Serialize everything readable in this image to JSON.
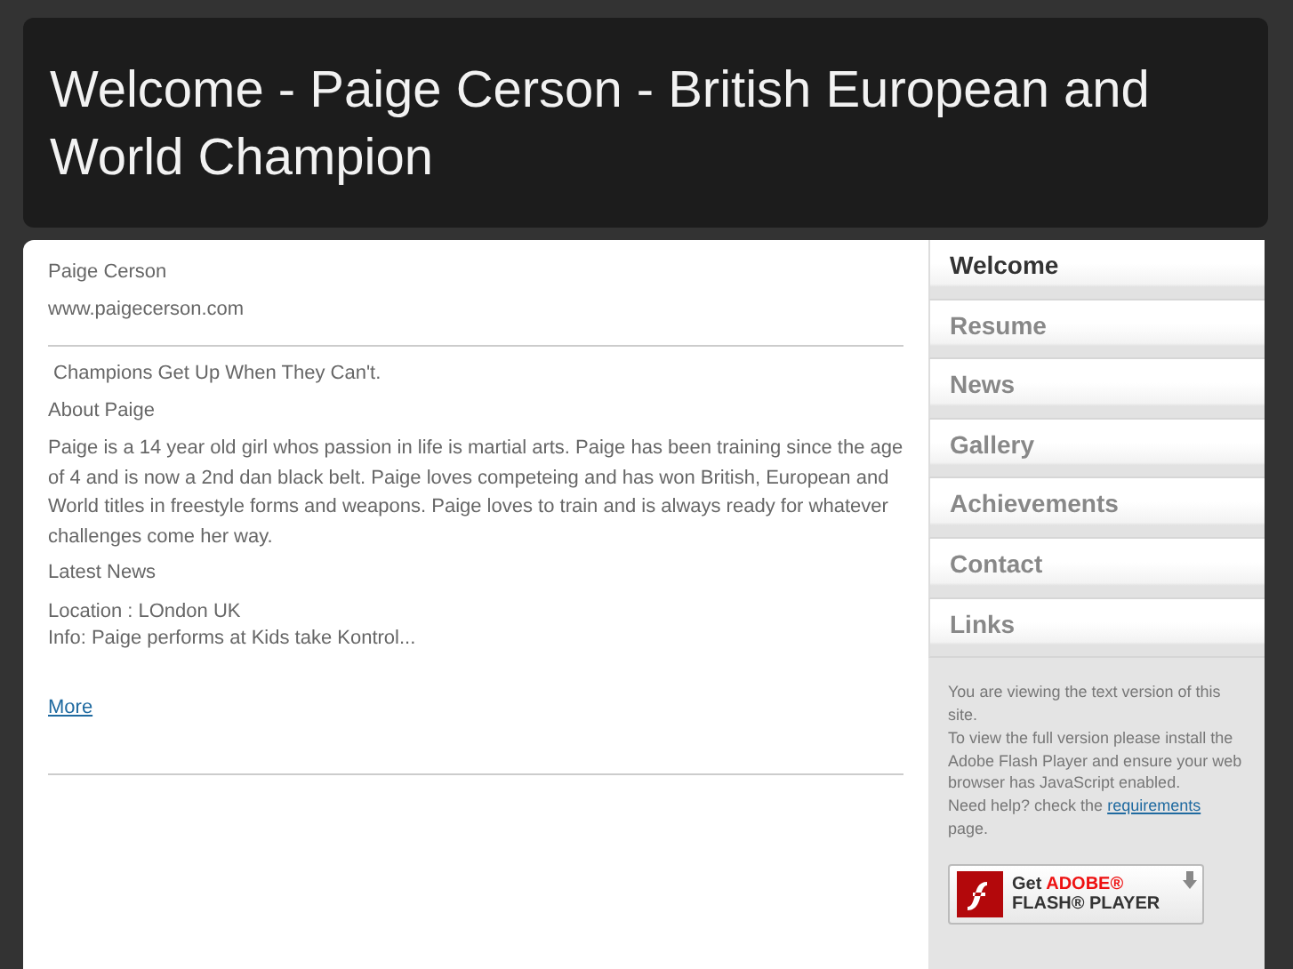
{
  "header": {
    "title": "Welcome - Paige Cerson - British European and World Champion"
  },
  "content": {
    "name": "Paige Cerson",
    "website": "www.paigecerson.com",
    "tagline": " Champions Get Up When They Can't.",
    "about_heading": "About Paige",
    "about_text": "Paige is a 14 year old girl whos passion in life is martial arts. Paige has been training since the age of 4 and is now a 2nd dan black belt. Paige loves competeing and has won British, European and World titles in freestyle forms and weapons. Paige loves to train and is always ready for whatever challenges come her way.",
    "news_heading": "Latest News",
    "news_location": "Location : LOndon UK",
    "news_info": "Info: Paige performs at Kids take Kontrol...",
    "more_link": "More"
  },
  "nav": [
    {
      "label": "Welcome",
      "selected": true
    },
    {
      "label": "Resume",
      "selected": false
    },
    {
      "label": "News",
      "selected": false
    },
    {
      "label": "Gallery",
      "selected": false
    },
    {
      "label": "Achievements",
      "selected": false
    },
    {
      "label": "Contact",
      "selected": false
    },
    {
      "label": "Links",
      "selected": false
    }
  ],
  "notice": {
    "line_1": "You are viewing the text version of this site.",
    "line_2": "To view the full version please install the Adobe Flash Player and ensure your web browser has JavaScript enabled.",
    "help_before": "Need help? check the",
    "help_link": "requirements",
    "help_after": "page."
  },
  "flash_badge": {
    "get": "Get",
    "brand": "ADOBE®",
    "product": "FLASH® PLAYER"
  }
}
